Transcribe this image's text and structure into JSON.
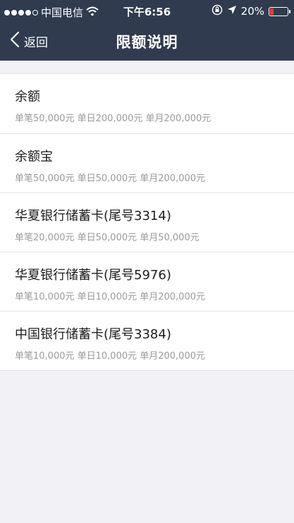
{
  "status_bar": {
    "carrier": "中国电信",
    "time": "下午6:56",
    "battery": "20%",
    "battery_level": 0.2,
    "battery_color": "#ff3b30",
    "signal_bars_filled": 4,
    "signal_bars_total": 5
  },
  "nav": {
    "back_label": "返回",
    "title": "限额说明"
  },
  "items": [
    {
      "name": "余额",
      "limits": "单笔50,000元 单日200,000元 单月200,000元"
    },
    {
      "name": "余额宝",
      "limits": "单笔50,000元 单日50,000元 单月200,000元"
    },
    {
      "name": "华夏银行储蓄卡(尾号3314)",
      "limits": "单笔20,000元 单日50,000元 单月50,000元"
    },
    {
      "name": "华夏银行储蓄卡(尾号5976)",
      "limits": "单笔10,000元 单日10,000元 单月200,000元"
    },
    {
      "name": "中国银行储蓄卡(尾号3384)",
      "limits": "单笔10,000元 单日10,000元 单月200,000元"
    }
  ],
  "colors": {
    "nav_background": "#303b4f",
    "page_background": "#f2f1f6"
  }
}
